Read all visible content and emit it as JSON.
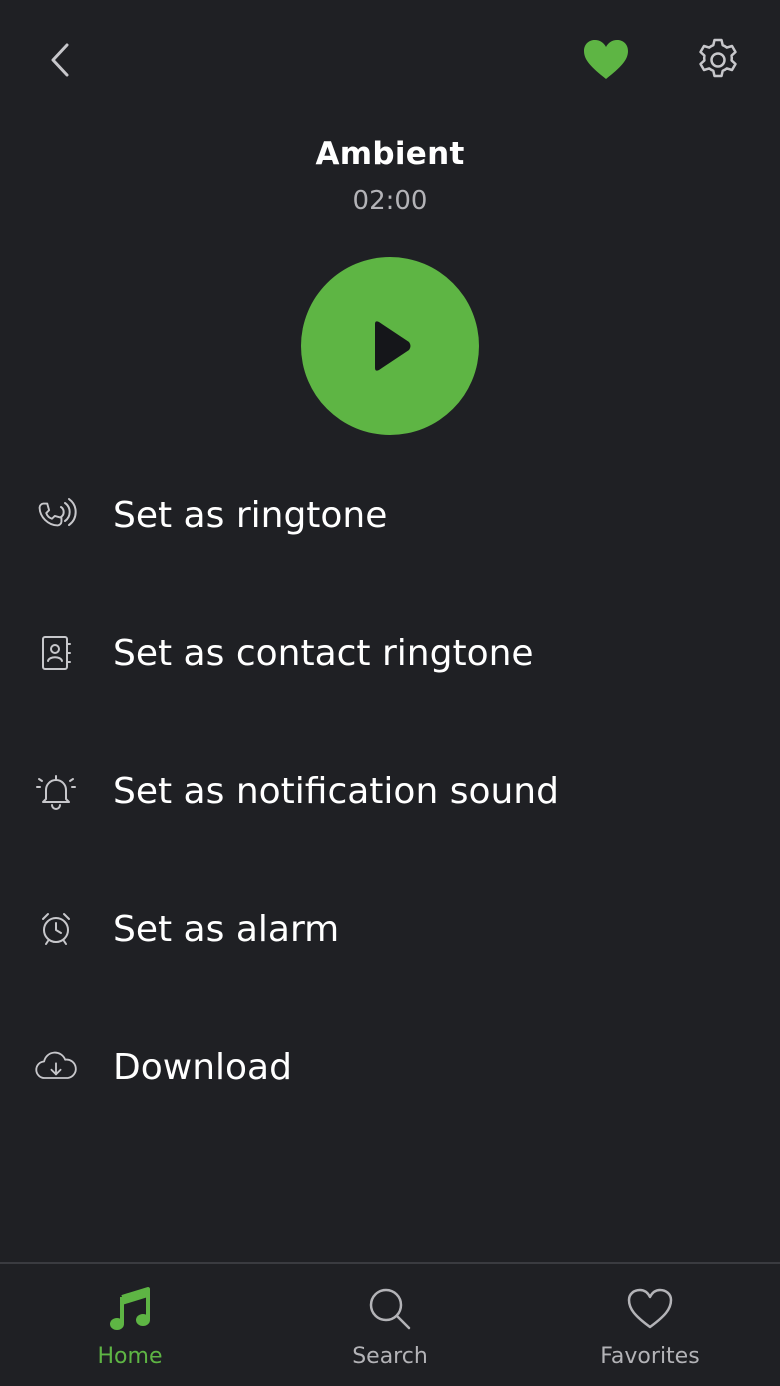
{
  "header": {
    "back_icon": "chevron-left-icon",
    "favorite_icon": "heart-filled-icon",
    "settings_icon": "gear-icon"
  },
  "track": {
    "title": "Ambient",
    "duration": "02:00"
  },
  "player": {
    "play_icon": "play-icon"
  },
  "menu": {
    "items": [
      {
        "icon": "ringing-phone-icon",
        "label": "Set as ringtone"
      },
      {
        "icon": "contact-book-icon",
        "label": "Set as contact ringtone"
      },
      {
        "icon": "notification-bell-icon",
        "label": "Set as notification sound"
      },
      {
        "icon": "alarm-clock-icon",
        "label": "Set as alarm"
      },
      {
        "icon": "cloud-download-icon",
        "label": "Download"
      }
    ]
  },
  "bottom_nav": {
    "items": [
      {
        "icon": "music-note-icon",
        "label": "Home",
        "active": true
      },
      {
        "icon": "search-icon",
        "label": "Search",
        "active": false
      },
      {
        "icon": "heart-outline-icon",
        "label": "Favorites",
        "active": false
      }
    ]
  },
  "colors": {
    "background": "#1f2024",
    "accent": "#5eb544",
    "secondary_text": "#b3b3b7",
    "icon_gray": "#c7c7cb"
  }
}
